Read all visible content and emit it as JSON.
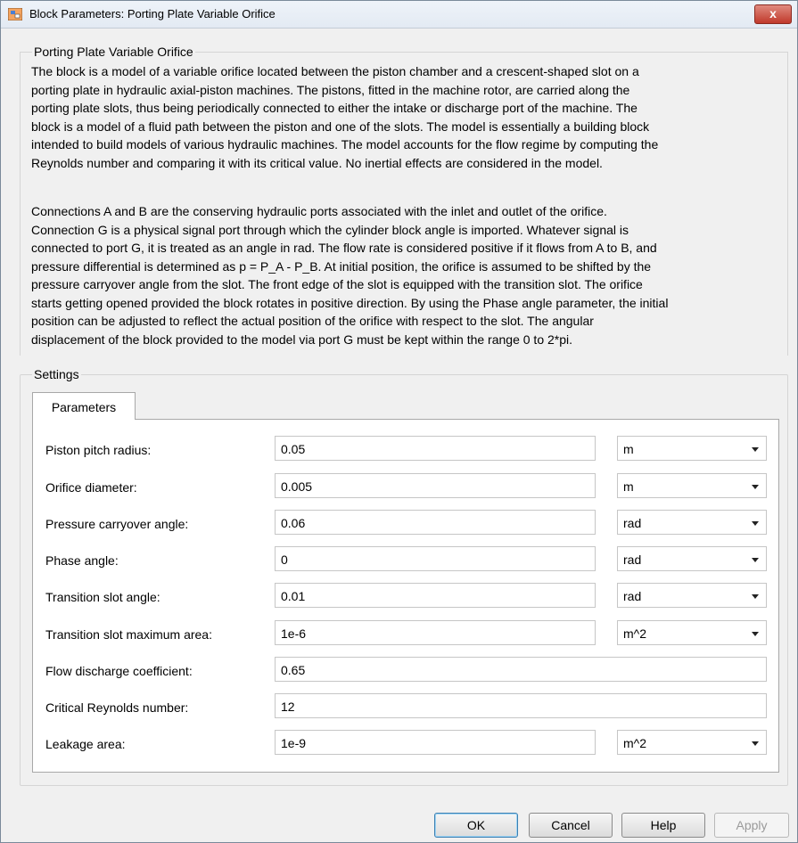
{
  "window": {
    "title": "Block Parameters: Porting Plate Variable Orifice",
    "close_label": "x"
  },
  "description": {
    "header": "Porting Plate Variable Orifice",
    "paragraph1_lines": [
      "The block is a model of a variable orifice located between the piston chamber and a crescent-shaped slot on a",
      "porting plate in hydraulic axial-piston machines. The pistons, fitted in the machine rotor, are carried along the",
      "porting plate slots, thus being periodically connected to either the intake or discharge port of the machine. The",
      "block is a model of a fluid path between the piston and one of the slots. The model is essentially a building block",
      "intended to build models of various hydraulic machines. The model accounts for the flow regime by computing the",
      "Reynolds number and comparing it with its critical value. No inertial effects are considered in the model."
    ],
    "paragraph2_lines": [
      "Connections A and B are the conserving hydraulic ports associated with the inlet and outlet of the orifice.",
      "Connection G is a physical signal port through which the cylinder block angle is imported. Whatever signal is",
      "connected to port G, it is treated as an angle in rad. The flow rate is considered positive if it flows from A to B, and",
      "pressure differential is determined as p = P_A - P_B. At initial position, the orifice is assumed to be shifted by the",
      "pressure carryover angle from the slot. The front edge of the slot is equipped with the transition slot. The orifice",
      "starts getting opened provided the block rotates in positive direction. By using the Phase angle parameter, the initial",
      "position can be adjusted to reflect the actual position of the orifice with respect to the slot. The angular",
      "displacement of the block provided to the model via port G must be kept within the range 0 to 2*pi."
    ]
  },
  "settings": {
    "label": "Settings",
    "tab": "Parameters",
    "params": [
      {
        "label": "Piston pitch radius:",
        "value": "0.05",
        "unit": "m"
      },
      {
        "label": "Orifice diameter:",
        "value": "0.005",
        "unit": "m"
      },
      {
        "label": "Pressure carryover angle:",
        "value": "0.06",
        "unit": "rad"
      },
      {
        "label": "Phase angle:",
        "value": "0",
        "unit": "rad"
      },
      {
        "label": "Transition slot angle:",
        "value": "0.01",
        "unit": "rad"
      },
      {
        "label": "Transition slot maximum area:",
        "value": "1e-6",
        "unit": "m^2"
      },
      {
        "label": "Flow discharge coefficient:",
        "value": "0.65",
        "unit": null
      },
      {
        "label": "Critical Reynolds number:",
        "value": "12",
        "unit": null
      },
      {
        "label": "Leakage area:",
        "value": "1e-9",
        "unit": "m^2"
      }
    ]
  },
  "buttons": {
    "ok": "OK",
    "cancel": "Cancel",
    "help": "Help",
    "apply": "Apply"
  },
  "colors": {
    "close_button": "#c0392b",
    "dialog_background": "#f0f0f0"
  }
}
